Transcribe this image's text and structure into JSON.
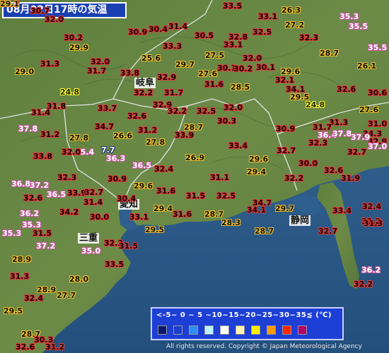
{
  "title": "08月02日17時の気温",
  "prefectures": [
    {
      "id": "gifu",
      "label": "岐阜"
    },
    {
      "id": "aichi",
      "label": "愛知"
    },
    {
      "id": "shizuoka",
      "label": "静岡"
    },
    {
      "id": "mie",
      "label": "三重"
    }
  ],
  "legend": {
    "ranges_text": "<-5~ 0 ~ 5 ~10~15~20~25~30~35≦ (℃)",
    "swatch_colors": [
      "#0a1a6b",
      "#1a3fd0",
      "#2f8ff2",
      "#bdf2ff",
      "#ffffff",
      "#fff7b5",
      "#fff200",
      "#ff9900",
      "#ff2800",
      "#b4006c"
    ]
  },
  "copyright": "All rights reserved. Copyright © Japan Meteorological Agency",
  "temperatures": [
    "30.7",
    "32.0",
    "33.5",
    "33.1",
    "26.3",
    "35.3",
    "30.2",
    "30.9",
    "30.4",
    "31.4",
    "30.5",
    "32.8",
    "27.2",
    "35.5",
    "29.9",
    "33.3",
    "33.1",
    "32.5",
    "32.3",
    "31.3",
    "32.0",
    "25.6",
    "27.5",
    "32.0",
    "30.1",
    "28.7",
    "35.5",
    "29.0",
    "31.7",
    "29.7",
    "27.6",
    "30.2",
    "30.1",
    "29.6",
    "26.1",
    "33.8",
    "32.9",
    "31.6",
    "28.5",
    "32.1",
    "32.6",
    "30.6",
    "24.8",
    "32.2",
    "31.7",
    "34.1",
    "29.5",
    "31.8",
    "33.7",
    "32.9",
    "32.2",
    "32.5",
    "32.0",
    "24.8",
    "27.6",
    "31.4",
    "32.6",
    "30.3",
    "31.3",
    "31.0",
    "37.8",
    "34.7",
    "28.7",
    "30.9",
    "31.7",
    "36.4",
    "34.3",
    "31.2",
    "27.8",
    "26.6",
    "31.2",
    "33.9",
    "32.9",
    "37.8",
    "37.9",
    "33.8",
    "35.4",
    "27.8",
    "33.4",
    "32.3",
    "32.7",
    "37.0",
    "32.0",
    "7.7",
    "29.6",
    "32.7",
    "33.8",
    "36.3",
    "26.9",
    "30.0",
    "32.3",
    "36.5",
    "32.4",
    "29.4",
    "32.6",
    "36.8",
    "37.2",
    "30.9",
    "31.1",
    "32.2",
    "31.9",
    "36.5",
    "33.9",
    "29.6",
    "31.6",
    "31.5",
    "32.5",
    "36.2",
    "32.7",
    "32.6",
    "30.4",
    "34.7",
    "35.3",
    "34.2",
    "31.4",
    "29.4",
    "34.1",
    "32.4",
    "35.3",
    "33.1",
    "28.7",
    "29.7",
    "33.4",
    "33.2",
    "31.5",
    "30.0",
    "31.6",
    "28.3",
    "31.3",
    "37.2",
    "32.3",
    "29.5",
    "28.7",
    "31.5",
    "35.0",
    "32.7",
    "28.9",
    "33.5",
    "36.2",
    "28.0",
    "32.2",
    "31.3",
    "28.9",
    "32.4",
    "27.7",
    "29.5",
    "28.7",
    "30.3",
    "32.6",
    "31.2",
    "31.2",
    "35.0",
    "31.7",
    "29.1"
  ]
}
